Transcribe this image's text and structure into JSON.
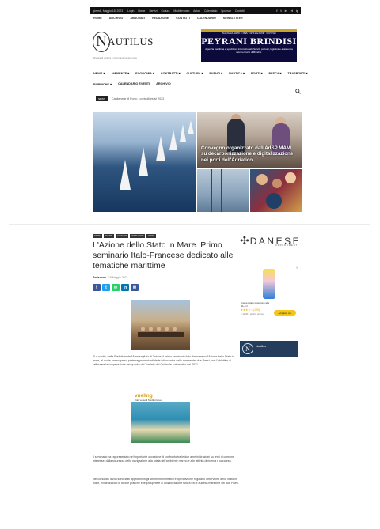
{
  "topbar": {
    "date": "giovedì, Maggio 18, 2023",
    "links": [
      "Login",
      "Home",
      "Servizi",
      "Cultura",
      "Mediterraneo",
      "Autori",
      "Calendario",
      "Sponsor",
      "Contatti"
    ],
    "social": [
      "f",
      "t",
      "in",
      "yt",
      "ig"
    ]
  },
  "secnav": {
    "items": [
      "HOME",
      "ARCHIVIO",
      "ABBONATI",
      "REDAZIONE",
      "CONTATTI",
      "CALENDARIO",
      "NEWSLETTER"
    ]
  },
  "logo": {
    "mark": "N",
    "word": "AUTILUS",
    "tagline": "Rivista di cultura e informazione del mare"
  },
  "ad_banner": {
    "kicker": "AGENZIA MARITTIMA · SPEDIZIONI · SERVIZI",
    "name": "PEYRANI BRINDISI",
    "desc": "Agenzia marittima e spedizioni internazionali. Servizi portuali, logistica e assistenza navi nel porto di Brindisi."
  },
  "mainmenu": {
    "row1": [
      "NEWS ▾",
      "AMBIENTE ▾",
      "ECONOMIA ▾",
      "CONTRATTI ▾",
      "CULTURA ▾",
      "EVENTI ▾",
      "NAUTICA ▾",
      "PORTI ▾",
      "PESCA ▾",
      "TRASPORTI ▾"
    ],
    "row2": [
      "RUBRICHE ▾",
      "CALENDARIO EVENTI",
      "ARCHIVIO"
    ]
  },
  "ticker": {
    "tag": "NEWS",
    "text": "Capitanerie di Porto: i controlli estivi 2023"
  },
  "hero": {
    "top_right_caption": "Convegno organizzato dall'AdSP MAM su decarbonizzazione e digitalizzazione nei porti dell'Adriatico"
  },
  "article": {
    "categories": [
      "NEWS",
      "EVENTI",
      "CULTURA",
      "ISTITUZIONI",
      "MARE"
    ],
    "title": "L'Azione dello Stato in Mare. Primo seminario Italo-Francese dedicato alle tematiche marittime",
    "author": "Redazione",
    "date": "18 Maggio 2023",
    "share": [
      {
        "label": "f",
        "color": "#3b5998"
      },
      {
        "label": "t",
        "color": "#1da1f2"
      },
      {
        "label": "w",
        "color": "#25d366"
      },
      {
        "label": "in",
        "color": "#0077b5"
      },
      {
        "label": "✉",
        "color": "#3b5998"
      }
    ],
    "para1": "Si è svolto, nella Prefettura dell'Ammiragliato di Tolone, il primo seminario italo-francese sull'Azione dello Stato in mare, al quale hanno preso parte rappresentanti delle istituzioni e delle marine dei due Paesi, con l'obiettivo di rafforzare la cooperazione nel quadro del Trattato del Quirinale sottoscritto nel 2021.",
    "ad2_brand": "vueling",
    "ad2_sub": "Vola verso il Mediterraneo",
    "para2": "Il seminario ha rappresentato un'importante occasione di confronto tra le due amministrazioni su temi di comune interesse, dalla sicurezza della navigazione alla tutela dell'ambiente marino e alle attività di ricerca e soccorso.",
    "para3": "Nel corso dei lavori sono stati approfonditi gli strumenti normativi e operativi che regolano l'intervento dello Stato in mare, evidenziando le buone pratiche e le prospettive di collaborazione futura tra le autorità marittime dei due Paesi."
  },
  "sidebar": {
    "logo_text": "DANESE",
    "logo_sub": "ARREDAMENTI",
    "ad": {
      "close": "✕",
      "product_name": "Crema solare protezione alta 50+ ml",
      "stars": "★★★★☆ (128)",
      "price": "€ 12,90 · prezzo promo",
      "buy": "Acquista ora"
    },
    "box_mark": "N",
    "box_text": "Nautilus"
  }
}
